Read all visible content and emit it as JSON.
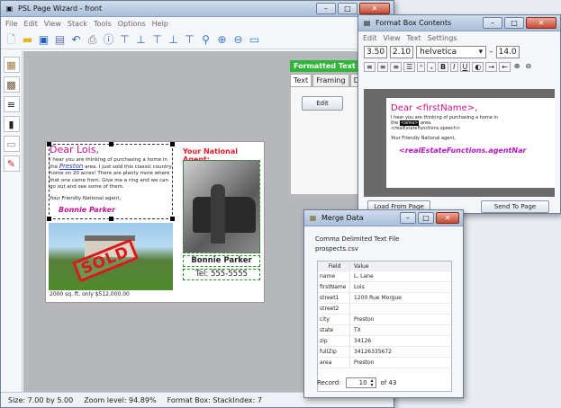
{
  "main": {
    "title": "PSL Page Wizard - front",
    "menu": [
      "File",
      "Edit",
      "View",
      "Stack",
      "Tools",
      "Options",
      "Help"
    ],
    "status": {
      "size": "Size: 7.00 by 5.00",
      "zoom": "Zoom level: 94.89%",
      "format": "Format Box: StackIndex: 7"
    }
  },
  "card": {
    "greeting": "Dear Lois,",
    "body_prefix": "I hear you are thinking of purchasing a home in the",
    "town": "Preston",
    "body_rest": "area. I just sold this classic country home on 20 acres! There are plenty more where that one came from. Give me a ring and we can go out and see some of them.",
    "signoff": "Your Friendly National agent,",
    "agent": "Bonnie Parker",
    "caption": "2000 sq. ft. only $512,000.00",
    "right_title": "Your National Agent:",
    "right_name": "Bonnie Parker",
    "right_tel": "Tel: 555-5555",
    "stamp": "SOLD"
  },
  "panel": {
    "header": "Formatted Text",
    "tabs": [
      "Text",
      "Framing",
      "D"
    ],
    "edit": "Edit"
  },
  "fmt": {
    "title": "Format Box Contents",
    "menu": [
      "Edit",
      "View",
      "Text",
      "Settings"
    ],
    "width": "3.50",
    "height": "2.10",
    "font": "helvetica",
    "size": "14.0",
    "preview_greeting": "Dear <firstName>,",
    "preview_line1": "I hear you are thinking of purchasing a home in",
    "preview_line2a": "the",
    "preview_area": "<area>",
    "preview_line2b": "area.",
    "preview_line3": "<realEstateFunctions.speech>",
    "preview_line4": "Your Friendly National agent,",
    "preview_func": "<realEstateFunctions.agentNar",
    "load": "Load From Page",
    "send": "Send To Page"
  },
  "merge": {
    "title": "Merge Data",
    "file_type": "Comma Delimited Text File",
    "file": "prospects.csv",
    "col_field": "Field",
    "col_value": "Value",
    "rows": [
      {
        "k": "name",
        "v": "L. Lane"
      },
      {
        "k": "firstName",
        "v": "Lois"
      },
      {
        "k": "street1",
        "v": "1200 Rue Morgue"
      },
      {
        "k": "street2",
        "v": ""
      },
      {
        "k": "city",
        "v": "Preston"
      },
      {
        "k": "state",
        "v": "TX"
      },
      {
        "k": "zip",
        "v": "34126"
      },
      {
        "k": "fullZip",
        "v": "34126335672"
      },
      {
        "k": "area",
        "v": "Preston"
      }
    ],
    "record_label": "Record:",
    "record_value": "10",
    "record_of": "of 43"
  },
  "colors": {
    "accent": "#e0116e",
    "panel_green": "#31b43a",
    "sold_red": "#d81a1a"
  }
}
